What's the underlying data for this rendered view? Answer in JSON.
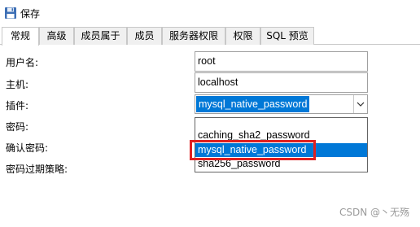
{
  "toolbar": {
    "save_label": "保存",
    "save_icon": "save-icon"
  },
  "tabs": [
    {
      "label": "常规",
      "active": true
    },
    {
      "label": "高级"
    },
    {
      "label": "成员属于"
    },
    {
      "label": "成员"
    },
    {
      "label": "服务器权限"
    },
    {
      "label": "权限"
    },
    {
      "label": "SQL 预览"
    }
  ],
  "form": {
    "username_label": "用户名:",
    "username_value": "root",
    "host_label": "主机:",
    "host_value": "localhost",
    "plugin_label": "插件:",
    "plugin_value": "mysql_native_password",
    "password_label": "密码:",
    "confirm_password_label": "确认密码:",
    "password_expire_label": "密码过期策略:"
  },
  "plugin_options": [
    "caching_sha2_password",
    "mysql_native_password",
    "sha256_password"
  ],
  "plugin_selected_index": 1,
  "colors": {
    "selection": "#0078d7",
    "highlight_box": "#e02020"
  },
  "watermark": "CSDN @丶无殇"
}
